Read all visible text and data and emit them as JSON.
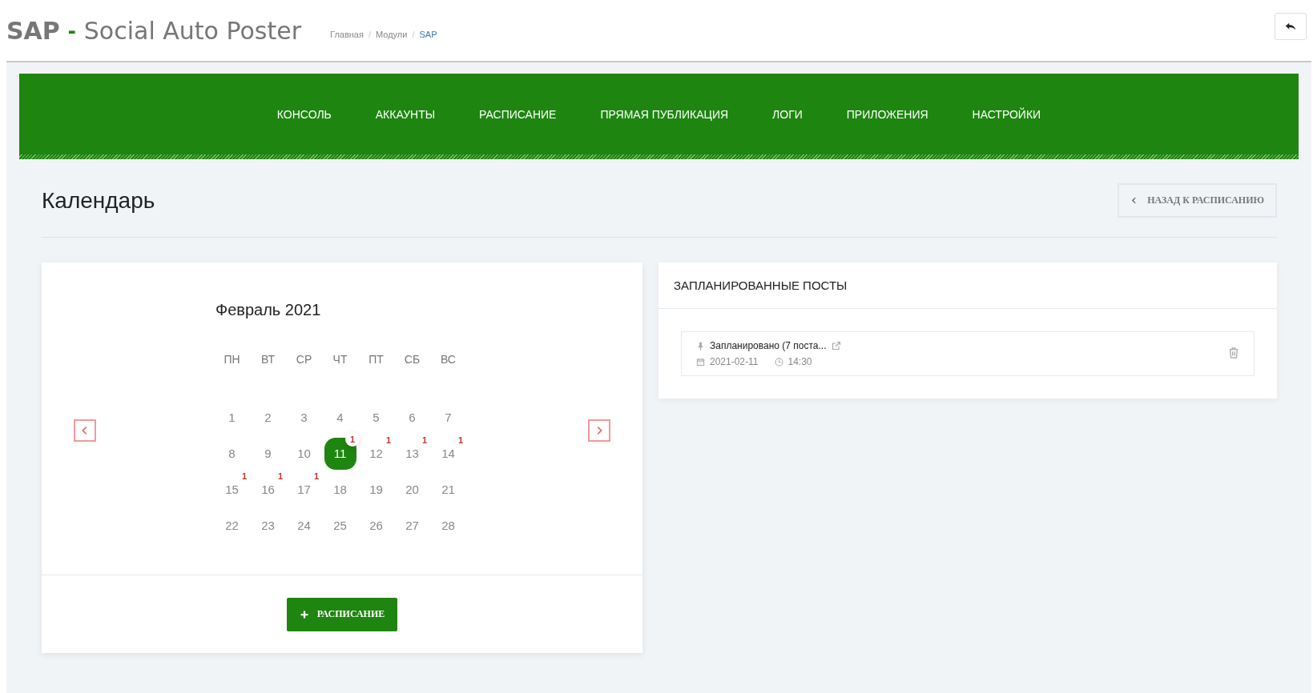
{
  "header": {
    "brand": "SAP",
    "separator": "-",
    "title": "Social Auto Poster",
    "breadcrumbs": [
      {
        "label": "Главная",
        "current": false
      },
      {
        "separator": "/",
        "label": "Модули",
        "current": false
      },
      {
        "separator": "/",
        "label": "SAP",
        "current": true
      }
    ]
  },
  "nav": [
    {
      "label": "КОНСОЛЬ"
    },
    {
      "label": "АККАУНТЫ"
    },
    {
      "label": "РАСПИСАНИЕ"
    },
    {
      "label": "ПРЯМАЯ ПУБЛИКАЦИЯ"
    },
    {
      "label": "ЛОГИ"
    },
    {
      "label": "ПРИЛОЖЕНИЯ"
    },
    {
      "label": "НАСТРОЙКИ"
    }
  ],
  "page": {
    "title": "Календарь",
    "back_button": "НАЗАД К РАСПИСАНИЮ"
  },
  "calendar": {
    "month": "Февраль 2021",
    "weekdays": [
      "ПН",
      "ВТ",
      "СР",
      "ЧТ",
      "ПТ",
      "СБ",
      "ВС"
    ],
    "days": [
      {
        "label": "1",
        "selected": false
      },
      {
        "label": "2",
        "selected": false
      },
      {
        "label": "3",
        "selected": false
      },
      {
        "label": "4",
        "selected": false
      },
      {
        "label": "5",
        "selected": false
      },
      {
        "label": "6",
        "selected": false
      },
      {
        "label": "7",
        "selected": false
      },
      {
        "label": "8",
        "selected": false
      },
      {
        "label": "9",
        "selected": false
      },
      {
        "label": "10",
        "selected": false
      },
      {
        "label": "11",
        "selected": true,
        "count": "1"
      },
      {
        "label": "12",
        "selected": false,
        "count": "1"
      },
      {
        "label": "13",
        "selected": false,
        "count": "1"
      },
      {
        "label": "14",
        "selected": false,
        "count": "1"
      },
      {
        "label": "15",
        "selected": false,
        "count": "1"
      },
      {
        "label": "16",
        "selected": false,
        "count": "1"
      },
      {
        "label": "17",
        "selected": false,
        "count": "1"
      },
      {
        "label": "18",
        "selected": false
      },
      {
        "label": "19",
        "selected": false
      },
      {
        "label": "20",
        "selected": false
      },
      {
        "label": "21",
        "selected": false
      },
      {
        "label": "22",
        "selected": false
      },
      {
        "label": "23",
        "selected": false
      },
      {
        "label": "24",
        "selected": false
      },
      {
        "label": "25",
        "selected": false
      },
      {
        "label": "26",
        "selected": false
      },
      {
        "label": "27",
        "selected": false
      },
      {
        "label": "28",
        "selected": false
      }
    ],
    "add_button": "РАСПИСАНИЕ"
  },
  "scheduled": {
    "title": "ЗАПЛАНИРОВАННЫЕ ПОСТЫ",
    "posts": [
      {
        "title": "Запланировано (7 поста...",
        "date": "2021-02-11",
        "time": "14:30"
      }
    ]
  }
}
